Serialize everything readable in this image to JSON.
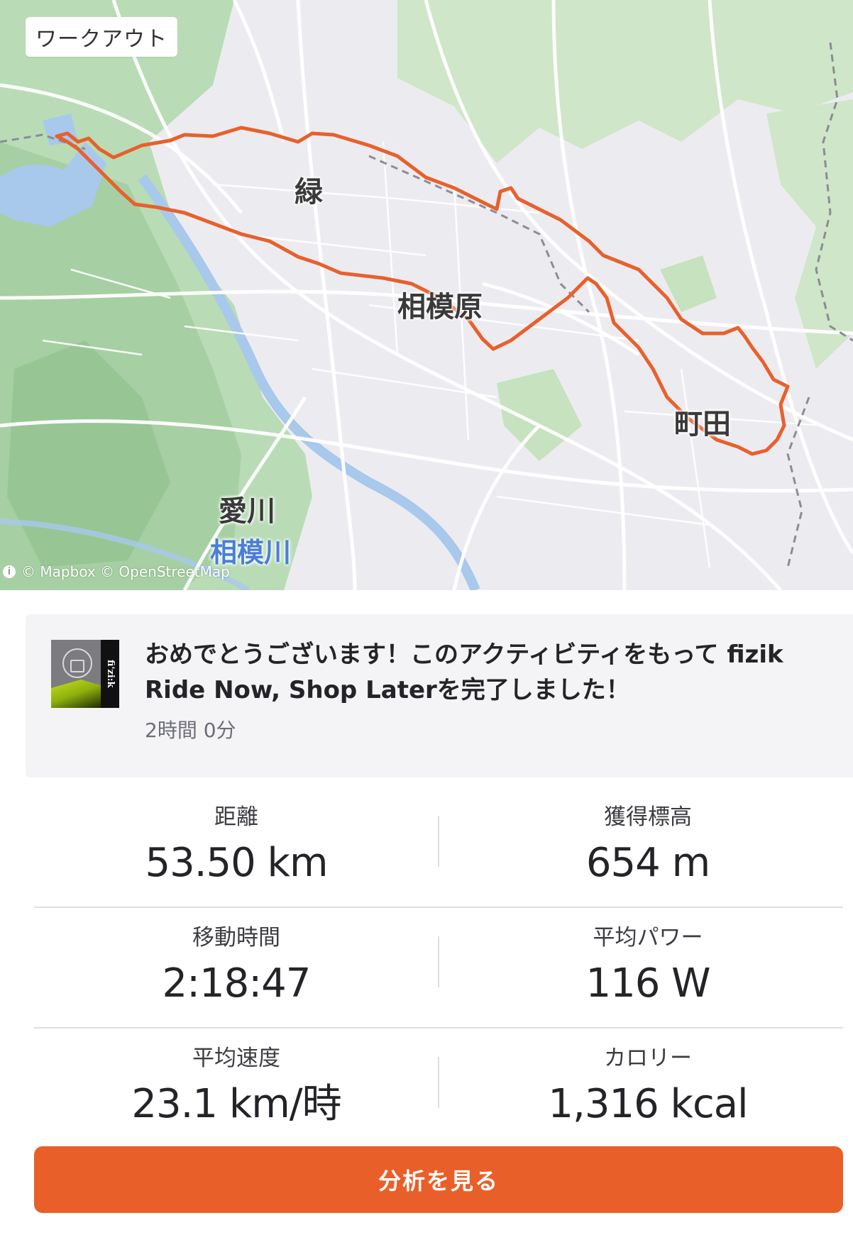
{
  "map": {
    "badge": "ワークアウト",
    "labels": {
      "midori": "緑",
      "sagamihara": "相模原",
      "machida": "町田",
      "aikawa": "愛川",
      "sagamigawa": "相模川"
    },
    "attribution": "© Mapbox © OpenStreetMap",
    "route_color": "#e8602c"
  },
  "challenge": {
    "logo_text": "fi'zi:k",
    "title": "おめでとうございます！このアクティビティをもって fizik Ride Now, Shop Laterを完了しました！",
    "duration": "2時間 0分"
  },
  "stats": {
    "distance": {
      "label": "距離",
      "value": "53.50 km"
    },
    "elevation_gain": {
      "label": "獲得標高",
      "value": "654 m"
    },
    "moving_time": {
      "label": "移動時間",
      "value": "2:18:47"
    },
    "avg_power": {
      "label": "平均パワー",
      "value": "116 W"
    },
    "avg_speed": {
      "label": "平均速度",
      "value": "23.1 km/時"
    },
    "calories": {
      "label": "カロリー",
      "value": "1,316 kcal"
    }
  },
  "actions": {
    "view_analysis": "分析を見る"
  },
  "colors": {
    "accent": "#e95f29",
    "card_bg": "#f4f4f6"
  }
}
